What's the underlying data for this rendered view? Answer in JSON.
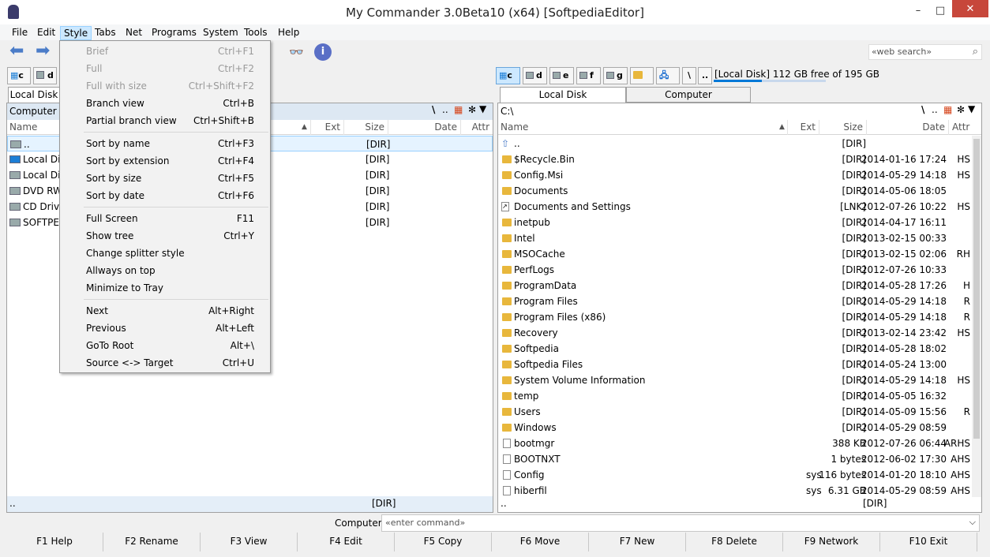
{
  "window": {
    "title": "My Commander 3.0Beta10 (x64) [SoftpediaEditor]",
    "min": "–",
    "max": "□",
    "close": "✕"
  },
  "menu": [
    "File",
    "Edit",
    "Style",
    "Tabs",
    "Net",
    "Programs",
    "System",
    "Tools",
    "Help"
  ],
  "toolbar": {
    "web_search_placeholder": "«web search»"
  },
  "left": {
    "drives": [
      "c",
      "d"
    ],
    "tabs": [
      "Local Disk"
    ],
    "path": "Computer",
    "headers": {
      "name": "Name",
      "ext": "Ext",
      "size": "Size",
      "date": "Date",
      "attr": "Attr"
    },
    "rows": [
      {
        "name": "..",
        "size": "[DIR]"
      },
      {
        "name": "Local Disk",
        "size": "[DIR]"
      },
      {
        "name": "Local Disk",
        "size": "[DIR]"
      },
      {
        "name": "DVD RW",
        "size": "[DIR]"
      },
      {
        "name": "CD Drive",
        "size": "[DIR]"
      },
      {
        "name": "SOFTPEDIA",
        "size": "[DIR]"
      }
    ],
    "status_name": "..",
    "status_size": "[DIR]"
  },
  "right": {
    "drives": [
      "c",
      "d",
      "e",
      "f",
      "g"
    ],
    "disk_info": "[Local Disk] 112 GB free of 195 GB",
    "disk_used_fraction": 0.43,
    "tabs": [
      "Local Disk",
      "Computer"
    ],
    "path": "C:\\",
    "headers": {
      "name": "Name",
      "ext": "Ext",
      "size": "Size",
      "date": "Date",
      "attr": "Attr"
    },
    "rows": [
      {
        "name": "..",
        "ext": "",
        "size": "[DIR]",
        "date": "",
        "attr": "",
        "kind": "up"
      },
      {
        "name": "$Recycle.Bin",
        "ext": "",
        "size": "[DIR]",
        "date": "2014-01-16 17:24",
        "attr": "HS",
        "kind": "dir"
      },
      {
        "name": "Config.Msi",
        "ext": "",
        "size": "[DIR]",
        "date": "2014-05-29 14:18",
        "attr": "HS",
        "kind": "dir"
      },
      {
        "name": "Documents",
        "ext": "",
        "size": "[DIR]",
        "date": "2014-05-06 18:05",
        "attr": "",
        "kind": "dir"
      },
      {
        "name": "Documents and Settings",
        "ext": "",
        "size": "[LNK]",
        "date": "2012-07-26 10:22",
        "attr": "HS",
        "kind": "lnk"
      },
      {
        "name": "inetpub",
        "ext": "",
        "size": "[DIR]",
        "date": "2014-04-17 16:11",
        "attr": "",
        "kind": "dir"
      },
      {
        "name": "Intel",
        "ext": "",
        "size": "[DIR]",
        "date": "2013-02-15 00:33",
        "attr": "",
        "kind": "dir"
      },
      {
        "name": "MSOCache",
        "ext": "",
        "size": "[DIR]",
        "date": "2013-02-15 02:06",
        "attr": "RH",
        "kind": "dir"
      },
      {
        "name": "PerfLogs",
        "ext": "",
        "size": "[DIR]",
        "date": "2012-07-26 10:33",
        "attr": "",
        "kind": "dir"
      },
      {
        "name": "ProgramData",
        "ext": "",
        "size": "[DIR]",
        "date": "2014-05-28 17:26",
        "attr": "H",
        "kind": "dir"
      },
      {
        "name": "Program Files",
        "ext": "",
        "size": "[DIR]",
        "date": "2014-05-29 14:18",
        "attr": "R",
        "kind": "dir"
      },
      {
        "name": "Program Files (x86)",
        "ext": "",
        "size": "[DIR]",
        "date": "2014-05-29 14:18",
        "attr": "R",
        "kind": "dir"
      },
      {
        "name": "Recovery",
        "ext": "",
        "size": "[DIR]",
        "date": "2013-02-14 23:42",
        "attr": "HS",
        "kind": "dir"
      },
      {
        "name": "Softpedia",
        "ext": "",
        "size": "[DIR]",
        "date": "2014-05-28 18:02",
        "attr": "",
        "kind": "dir"
      },
      {
        "name": "Softpedia Files",
        "ext": "",
        "size": "[DIR]",
        "date": "2014-05-24 13:00",
        "attr": "",
        "kind": "dir"
      },
      {
        "name": "System Volume Information",
        "ext": "",
        "size": "[DIR]",
        "date": "2014-05-29 14:18",
        "attr": "HS",
        "kind": "dir"
      },
      {
        "name": "temp",
        "ext": "",
        "size": "[DIR]",
        "date": "2014-05-05 16:32",
        "attr": "",
        "kind": "dir"
      },
      {
        "name": "Users",
        "ext": "",
        "size": "[DIR]",
        "date": "2014-05-09 15:56",
        "attr": "R",
        "kind": "dir"
      },
      {
        "name": "Windows",
        "ext": "",
        "size": "[DIR]",
        "date": "2014-05-29 08:59",
        "attr": "",
        "kind": "dir"
      },
      {
        "name": "bootmgr",
        "ext": "",
        "size": "388 KB",
        "date": "2012-07-26 06:44",
        "attr": "ARHS",
        "kind": "file"
      },
      {
        "name": "BOOTNXT",
        "ext": "",
        "size": "1 bytes",
        "date": "2012-06-02 17:30",
        "attr": "AHS",
        "kind": "file"
      },
      {
        "name": "Config",
        "ext": "sys",
        "size": "116 bytes",
        "date": "2014-01-20 18:10",
        "attr": "AHS",
        "kind": "file"
      },
      {
        "name": "hiberfil",
        "ext": "sys",
        "size": "6.31 GB",
        "date": "2014-05-29 08:59",
        "attr": "AHS",
        "kind": "file"
      }
    ],
    "status_name": "..",
    "status_size": "[DIR]"
  },
  "dropdown": [
    {
      "label": "Brief",
      "key": "Ctrl+F1",
      "disabled": true
    },
    {
      "label": "Full",
      "key": "Ctrl+F2",
      "disabled": true
    },
    {
      "label": "Full with size",
      "key": "Ctrl+Shift+F2",
      "disabled": true
    },
    {
      "label": "Branch view",
      "key": "Ctrl+B"
    },
    {
      "label": "Partial branch view",
      "key": "Ctrl+Shift+B"
    },
    {
      "sep": true
    },
    {
      "label": "Sort by name",
      "key": "Ctrl+F3"
    },
    {
      "label": "Sort by extension",
      "key": "Ctrl+F4"
    },
    {
      "label": "Sort by size",
      "key": "Ctrl+F5"
    },
    {
      "label": "Sort by date",
      "key": "Ctrl+F6"
    },
    {
      "sep": true
    },
    {
      "label": "Full Screen",
      "key": "F11"
    },
    {
      "label": "Show tree",
      "key": "Ctrl+Y"
    },
    {
      "label": "Change splitter style",
      "key": ""
    },
    {
      "label": "Allways on top",
      "key": ""
    },
    {
      "label": "Minimize to Tray",
      "key": ""
    },
    {
      "sep": true
    },
    {
      "label": "Next",
      "key": "Alt+Right"
    },
    {
      "label": "Previous",
      "key": "Alt+Left"
    },
    {
      "label": "GoTo Root",
      "key": "Alt+\\"
    },
    {
      "label": "Source <-> Target",
      "key": "Ctrl+U"
    }
  ],
  "command": {
    "label": "Computer",
    "placeholder": "«enter command»"
  },
  "fkeys": [
    "F1 Help",
    "F2 Rename",
    "F3 View",
    "F4 Edit",
    "F5 Copy",
    "F6 Move",
    "F7 New",
    "F8 Delete",
    "F9 Network",
    "F10 Exit"
  ],
  "colors": {
    "selection": "#cce8ff",
    "accent": "#0078d7",
    "folder": "#e8b73c"
  }
}
